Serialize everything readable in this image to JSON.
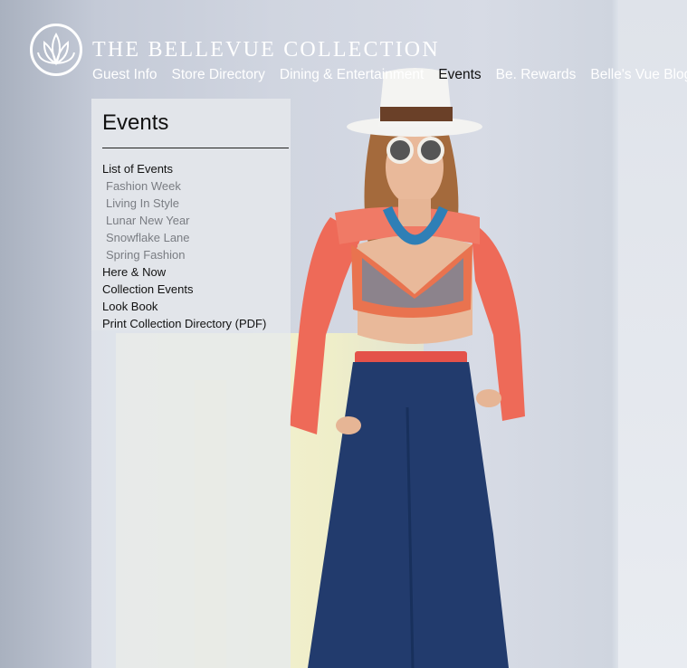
{
  "brand": {
    "name": "THE BELLEVUE COLLECTION",
    "logo_icon": "lotus-logo-icon"
  },
  "nav": {
    "items": [
      {
        "label": "Guest Info",
        "active": false
      },
      {
        "label": "Store Directory",
        "active": false
      },
      {
        "label": "Dining & Entertainment",
        "active": false
      },
      {
        "label": "Events",
        "active": true
      },
      {
        "label": "Be. Rewards",
        "active": false
      },
      {
        "label": "Belle's Vue Blog",
        "active": false
      }
    ]
  },
  "sidebar": {
    "title": "Events",
    "items": [
      {
        "label": "List of Events",
        "sub": false
      },
      {
        "label": "Fashion Week",
        "sub": true
      },
      {
        "label": "Living In Style",
        "sub": true
      },
      {
        "label": "Lunar New Year",
        "sub": true
      },
      {
        "label": "Snowflake Lane",
        "sub": true
      },
      {
        "label": "Spring Fashion",
        "sub": true
      },
      {
        "label": "Here & Now",
        "sub": false
      },
      {
        "label": "Collection Events",
        "sub": false
      },
      {
        "label": "Look Book",
        "sub": false
      },
      {
        "label": "Print Collection Directory (PDF)",
        "sub": false
      }
    ]
  },
  "colors": {
    "nav_text": "#ffffff",
    "nav_active": "#111111",
    "sub_item": "#7a7d83"
  }
}
